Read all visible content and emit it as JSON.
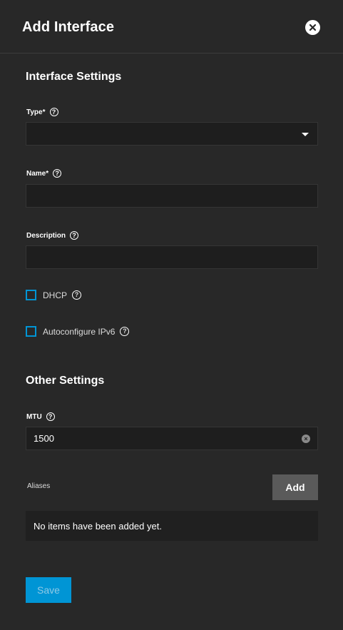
{
  "header": {
    "title": "Add Interface",
    "close_icon": "close-icon"
  },
  "interface_settings": {
    "title": "Interface Settings",
    "type": {
      "label": "Type",
      "required": "*",
      "value": ""
    },
    "name": {
      "label": "Name",
      "required": "*",
      "value": ""
    },
    "description": {
      "label": "Description",
      "value": ""
    },
    "dhcp": {
      "label": "DHCP",
      "checked": false
    },
    "ipv6": {
      "label": "Autoconfigure IPv6",
      "checked": false
    }
  },
  "other_settings": {
    "title": "Other Settings",
    "mtu": {
      "label": "MTU",
      "value": "1500"
    }
  },
  "aliases": {
    "label": "Aliases",
    "add_label": "Add",
    "empty_text": "No items have been added yet."
  },
  "footer": {
    "save_label": "Save"
  },
  "colors": {
    "accent": "#0095d5",
    "background": "#282828",
    "field": "#1e1e1e"
  }
}
